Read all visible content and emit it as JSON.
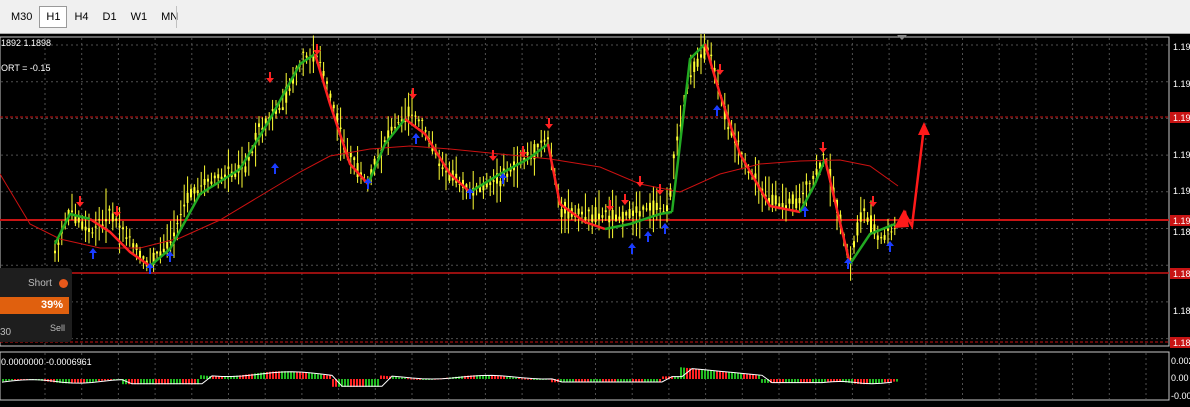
{
  "toolbar": {
    "timeframes": [
      {
        "label": "M30",
        "active": false
      },
      {
        "label": "H1",
        "active": true
      },
      {
        "label": "H4",
        "active": false
      },
      {
        "label": "D1",
        "active": false
      },
      {
        "label": "W1",
        "active": false
      },
      {
        "label": "MN",
        "active": false
      }
    ]
  },
  "chart": {
    "info_line1": "1892 1.1898",
    "info_line2": "ORT = -0.15",
    "price_labels": [
      "1.19",
      "1.19",
      "1.19",
      "1.19",
      "1.19",
      "1.19",
      "1.18",
      "1.18",
      "1.18",
      "1.18"
    ],
    "colors": {
      "bull_candle": "#ffff33",
      "bear_candle": "#ffff33",
      "trend_up": "#22aa22",
      "trend_down": "#ff2222",
      "signal_up": "#1a3cff",
      "signal_down": "#ff2222",
      "moving_average": "#cc1111",
      "level_line": "#c81414"
    }
  },
  "widget": {
    "short_label": "Short",
    "percent": "39%",
    "timeframe": "30",
    "sell_label": "Sell",
    "accent_color": "#e0600e"
  },
  "oscillator": {
    "label": "0.0000000 -0.0006961",
    "scale_labels": [
      "0.002",
      "0.00",
      "-0.00"
    ],
    "colors": {
      "positive": "#22bb22",
      "negative": "#ff2222",
      "signal": "#ffffff"
    }
  }
}
